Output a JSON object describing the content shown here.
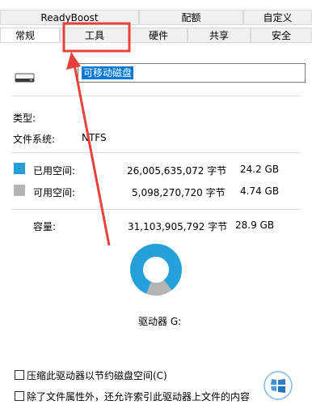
{
  "tabs_top": [
    {
      "label": "ReadyBoost"
    },
    {
      "label": "配额"
    },
    {
      "label": "自定义"
    }
  ],
  "tabs_bottom": [
    {
      "label": "常规"
    },
    {
      "label": "工具"
    },
    {
      "label": "硬件"
    },
    {
      "label": "共享"
    },
    {
      "label": "安全"
    }
  ],
  "general": {
    "drive_name": "可移动磁盘",
    "type_label": "类型:",
    "fs_label": "文件系统:",
    "fs_value": "NTFS",
    "used_label": "已用空间:",
    "used_bytes": "26,005,635,072 字节",
    "used_size": "24.2 GB",
    "free_label": "可用空间:",
    "free_bytes": "5,098,270,720 字节",
    "free_size": "4.74 GB",
    "capacity_label": "容量:",
    "capacity_bytes": "31,103,905,792 字节",
    "capacity_size": "28.9 GB",
    "drive_label": "驱动器 G:",
    "compress_label": "压缩此驱动器以节约磁盘空间(C)",
    "index_label": "除了文件属性外，还允许索引此驱动器上文件的内容"
  },
  "colors": {
    "used": "#26a0da",
    "free": "#b4b4b4",
    "annotation": "#e8403a"
  },
  "chart_data": {
    "type": "pie",
    "categories": [
      "已用空间",
      "可用空间"
    ],
    "values": [
      26005635072,
      5098270720
    ]
  }
}
